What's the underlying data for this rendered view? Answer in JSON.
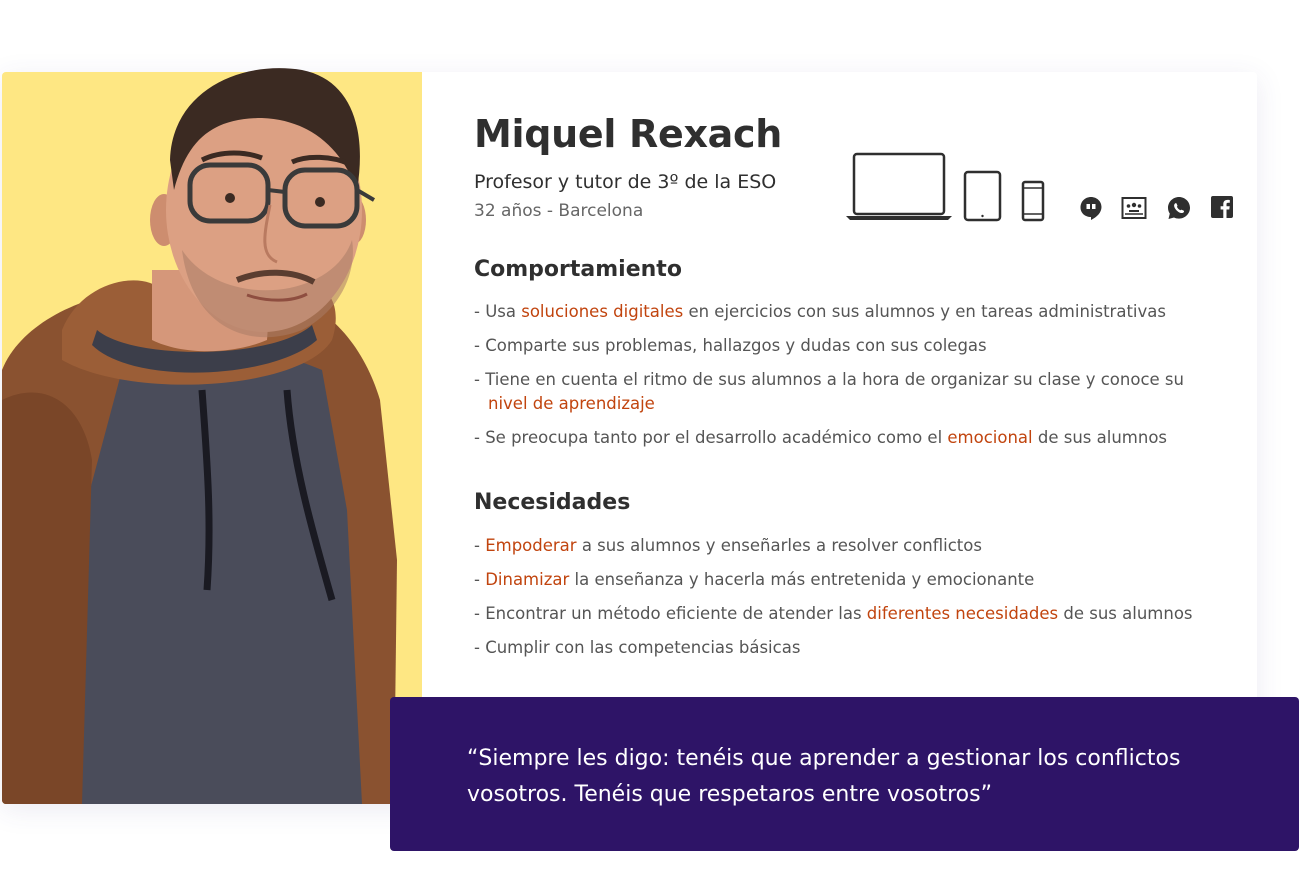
{
  "profile": {
    "name": "Miquel Rexach",
    "role": "Profesor y tutor de 3º de la ESO",
    "meta": "32 años - Barcelona"
  },
  "devices": [
    "laptop-icon",
    "tablet-icon",
    "smartphone-icon"
  ],
  "apps": [
    "hangouts-icon",
    "google-classroom-icon",
    "whatsapp-icon",
    "facebook-icon"
  ],
  "behavior": {
    "title": "Comportamiento",
    "items": [
      {
        "pre": "- Usa ",
        "hl": "soluciones digitales",
        "post": " en ejercicios con sus alumnos y en tareas administrativas"
      },
      {
        "pre": "- Comparte sus problemas, hallazgos y dudas con sus colegas",
        "hl": "",
        "post": ""
      },
      {
        "pre": "- Tiene en cuenta el ritmo de sus alumnos a la hora de organizar su clase y conoce su",
        "hl": "nivel de aprendizaje",
        "post": ""
      },
      {
        "pre": "- Se preocupa tanto por el desarrollo académico como el ",
        "hl": "emocional",
        "post": " de sus alumnos"
      }
    ]
  },
  "needs": {
    "title": "Necesidades",
    "items": [
      {
        "pre": "- ",
        "hl": "Empoderar",
        "post": " a sus alumnos y enseñarles a resolver conflictos"
      },
      {
        "pre": "- ",
        "hl": "Dinamizar",
        "post": " la enseñanza y hacerla más entretenida y emocionante"
      },
      {
        "pre": "- Encontrar un método eficiente de atender las ",
        "hl": "diferentes necesidades",
        "post": " de sus alumnos"
      },
      {
        "pre": "- Cumplir con las competencias básicas",
        "hl": "",
        "post": ""
      }
    ]
  },
  "quote": {
    "line1": "“Siempre les digo: tenéis que aprender a gestionar los conflictos",
    "line2": "vosotros. Tenéis que respetaros entre vosotros”"
  },
  "colors": {
    "accent": "#c1440e",
    "photo_bg": "#fee783",
    "quote_bg": "#2e1467"
  }
}
